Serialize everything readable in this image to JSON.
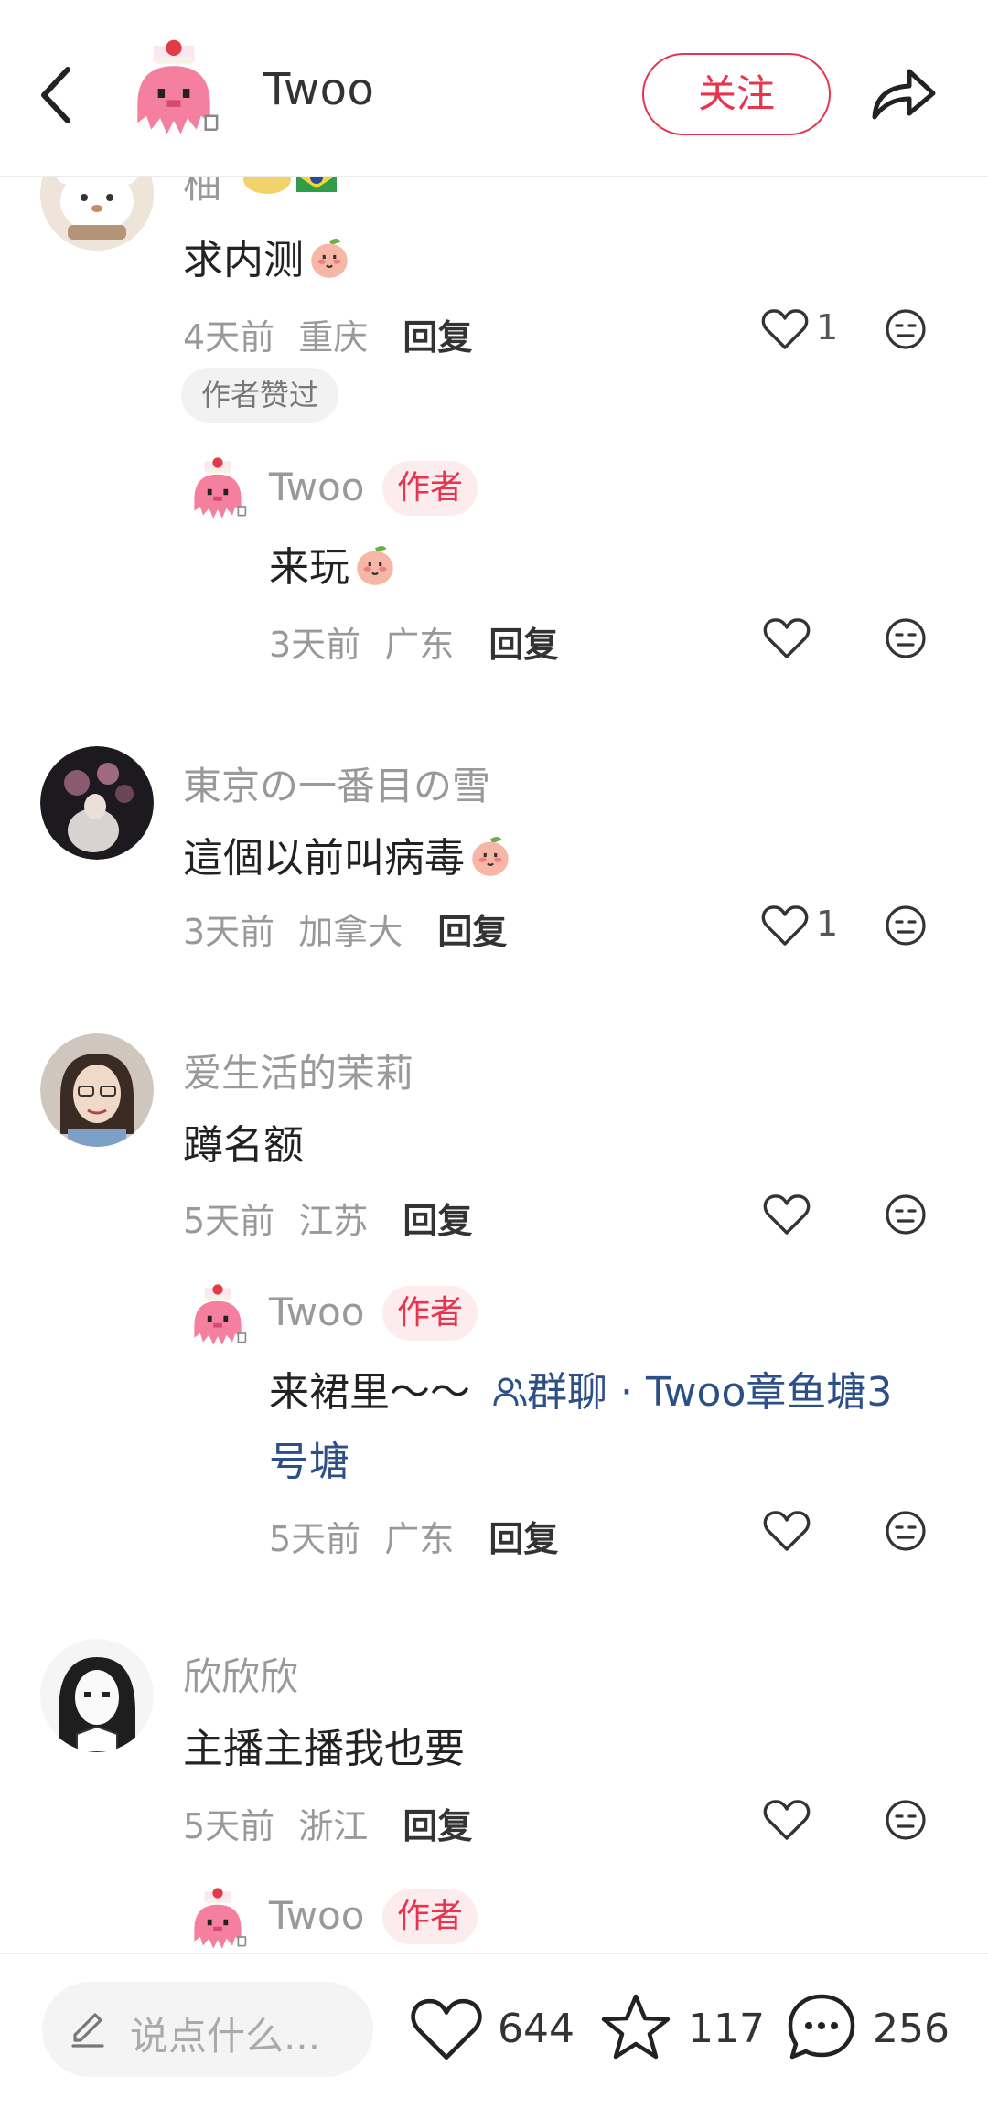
{
  "header": {
    "title": "Twoo",
    "follow_label": "关注"
  },
  "comments": [
    {
      "username": "柚",
      "text": "求内测",
      "time": "4天前",
      "location": "重庆",
      "reply_label": "回复",
      "likes": "1",
      "liked_by_author_label": "作者赞过",
      "sub_reply": {
        "username": "Twoo",
        "author_tag": "作者",
        "text": "来玩",
        "time": "3天前",
        "location": "广东",
        "reply_label": "回复"
      }
    },
    {
      "username": "東京の一番目の雪",
      "text": "這個以前叫病毒",
      "time": "3天前",
      "location": "加拿大",
      "reply_label": "回复",
      "likes": "1"
    },
    {
      "username": "爱生活的茉莉",
      "text": "蹲名额",
      "time": "5天前",
      "location": "江苏",
      "reply_label": "回复",
      "sub_reply": {
        "username": "Twoo",
        "author_tag": "作者",
        "text": "来裙里～～",
        "group_link_line1": "群聊 · Twoo章鱼塘3",
        "group_link_line2": "号塘",
        "time": "5天前",
        "location": "广东",
        "reply_label": "回复"
      }
    },
    {
      "username": "欣欣欣",
      "text": "主播主播我也要",
      "time": "5天前",
      "location": "浙江",
      "reply_label": "回复",
      "sub_reply": {
        "username": "Twoo",
        "author_tag": "作者"
      }
    }
  ],
  "bottom_bar": {
    "input_placeholder": "说点什么...",
    "likes": "644",
    "favorites": "117",
    "comments": "256"
  },
  "colors": {
    "accent": "#e8344e",
    "author_tag_bg": "#fdecee",
    "link": "#2b4f86",
    "muted_text": "#999999"
  }
}
